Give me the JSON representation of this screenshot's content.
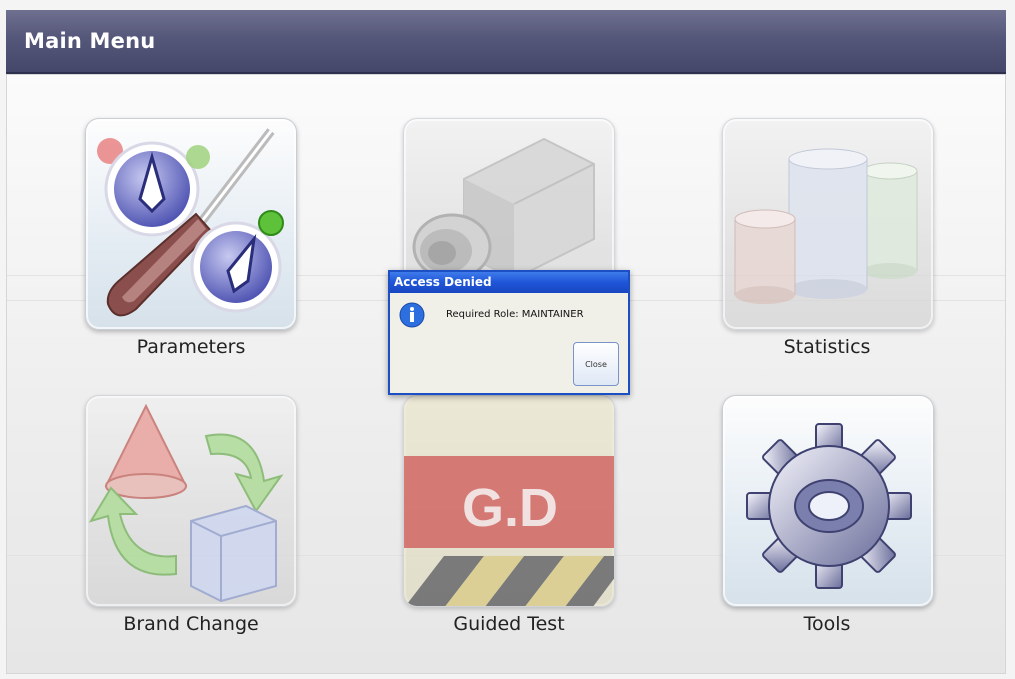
{
  "window": {
    "title": "Main Menu"
  },
  "menu": {
    "parameters": {
      "label": "Parameters",
      "icon": "screwdriver-dials-icon"
    },
    "camera": {
      "label": "",
      "icon": "camera-icon"
    },
    "statistics": {
      "label": "Statistics",
      "icon": "cylinders-icon"
    },
    "brand_change": {
      "label": "Brand Change",
      "icon": "cone-cube-arrows-icon"
    },
    "guided_test": {
      "label": "Guided Test",
      "icon": "gd-badge-icon",
      "badge_text": "G.D"
    },
    "tools": {
      "label": "Tools",
      "icon": "gear-icon"
    }
  },
  "dialog": {
    "title": "Access Denied",
    "message": "Required Role: MAINTAINER",
    "close_label": "Close"
  },
  "colors": {
    "titlebar": "#55577a",
    "dialog_border": "#1d4fc4",
    "dialog_header": "#1f55d8",
    "gd_badge": "#c93a36"
  }
}
